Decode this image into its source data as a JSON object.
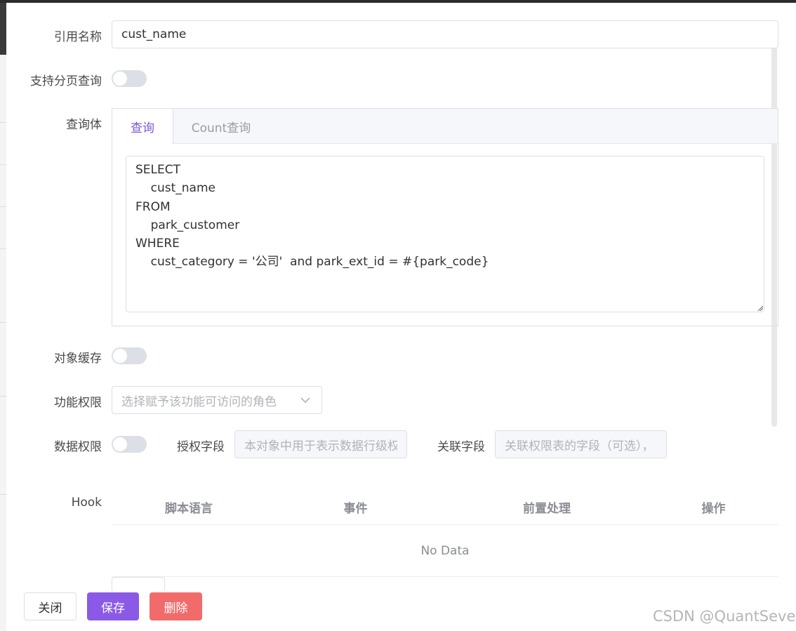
{
  "form": {
    "ref_name_label": "引用名称",
    "ref_name_value": "cust_name",
    "paging_label": "支持分页查询",
    "query_body_label": "查询体",
    "tabs": [
      "查询",
      "Count查询"
    ],
    "query_sql": "SELECT\n    cust_name\nFROM\n    park_customer\nWHERE\n    cust_category = '公司'  and park_ext_id = #{park_code}",
    "object_cache_label": "对象缓存",
    "func_perm_label": "功能权限",
    "func_perm_placeholder": "选择赋予该功能可访问的角色",
    "data_perm_label": "数据权限",
    "auth_field_label": "授权字段",
    "auth_field_placeholder": "本对象中用于表示数据行级权限的字段",
    "rel_field_label": "关联字段",
    "rel_field_placeholder": "关联权限表的字段（可选），",
    "hook_label": "Hook"
  },
  "hook_table": {
    "columns": [
      "脚本语言",
      "事件",
      "前置处理",
      "操作"
    ],
    "empty_text": "No Data"
  },
  "buttons": {
    "close": "关闭",
    "save": "保存",
    "delete": "删除"
  },
  "watermark": "CSDN @QuantSeven",
  "colors": {
    "accent": "#8a5ae6",
    "danger": "#f26b6b",
    "active_tab": "#7b55d8"
  }
}
